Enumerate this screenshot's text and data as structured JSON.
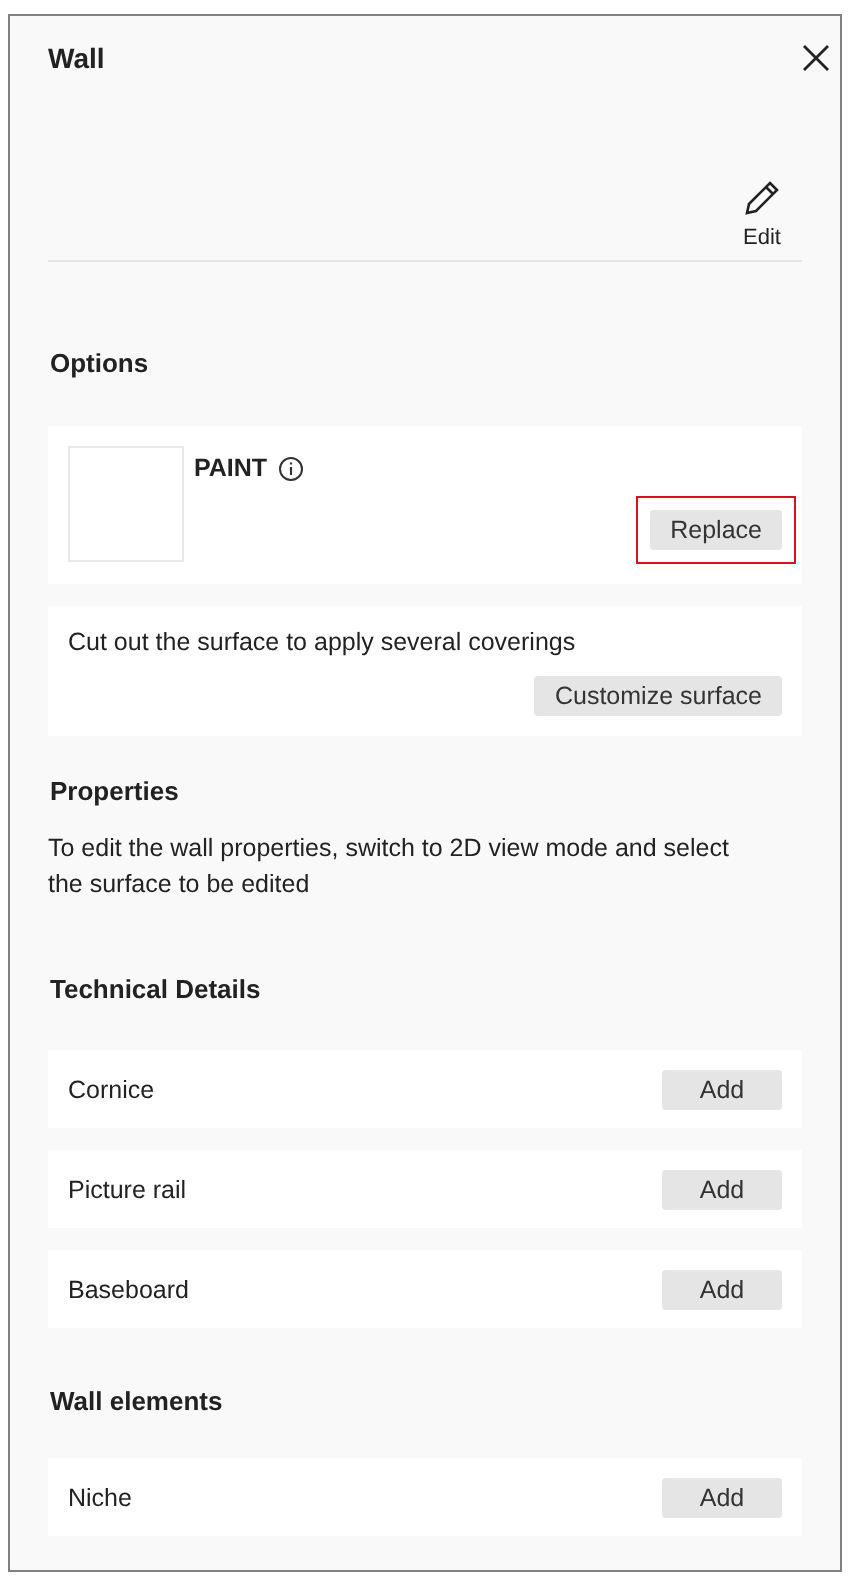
{
  "panel": {
    "title": "Wall",
    "edit_label": "Edit"
  },
  "options": {
    "heading": "Options",
    "covering": {
      "name": "PAINT",
      "button": "Replace",
      "button_highlighted": true
    },
    "customize": {
      "text": "Cut out the surface to apply several coverings",
      "button": "Customize surface"
    }
  },
  "properties": {
    "heading": "Properties",
    "text": "To edit the wall properties, switch to 2D view mode and select the surface to be edited"
  },
  "sections": [
    {
      "heading": "Technical Details",
      "rows": [
        {
          "label": "Cornice",
          "button": "Add"
        },
        {
          "label": "Picture rail",
          "button": "Add"
        },
        {
          "label": "Baseboard",
          "button": "Add"
        }
      ]
    },
    {
      "heading": "Wall elements",
      "rows": [
        {
          "label": "Niche",
          "button": "Add"
        }
      ]
    }
  ]
}
